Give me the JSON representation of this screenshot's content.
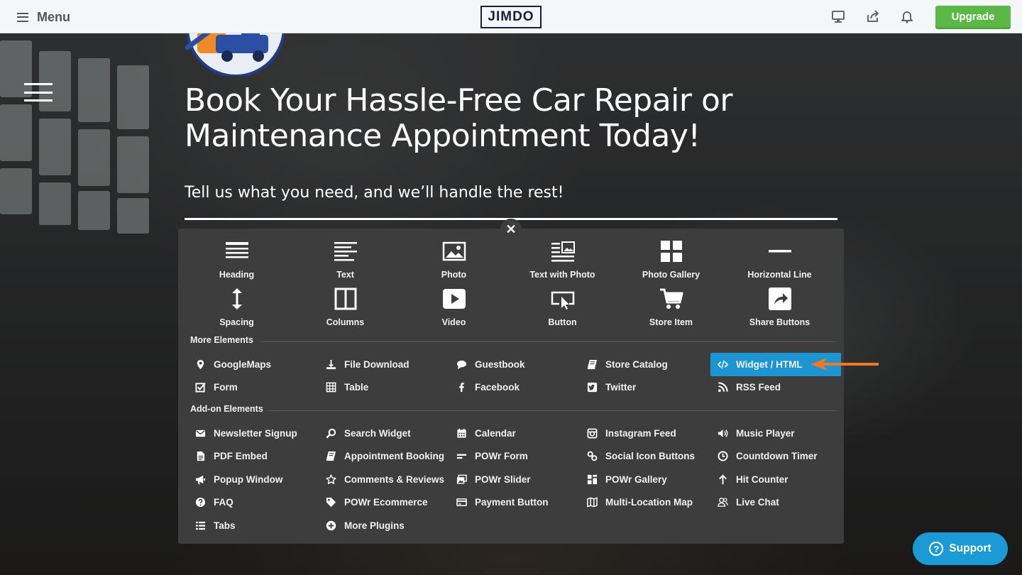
{
  "topbar": {
    "menu_label": "Menu",
    "logo_text": "JIMDO",
    "upgrade_label": "Upgrade",
    "icons": [
      "desktop-preview-icon",
      "share-icon",
      "bell-icon"
    ]
  },
  "hero": {
    "headline_line1": "Book Your Hassle-Free Car Repair or",
    "headline_line2": "Maintenance Appointment Today!",
    "subline": "Tell us what you need, and we’ll handle the rest!"
  },
  "panel": {
    "close_symbol": "✕",
    "basic_elements": [
      {
        "label": "Heading",
        "icon": "heading-icon"
      },
      {
        "label": "Text",
        "icon": "text-icon"
      },
      {
        "label": "Photo",
        "icon": "photo-icon"
      },
      {
        "label": "Text with Photo",
        "icon": "text-with-photo-icon"
      },
      {
        "label": "Photo Gallery",
        "icon": "photo-gallery-icon"
      },
      {
        "label": "Horizontal Line",
        "icon": "horizontal-line-icon"
      },
      {
        "label": "Spacing",
        "icon": "spacing-icon"
      },
      {
        "label": "Columns",
        "icon": "columns-icon"
      },
      {
        "label": "Video",
        "icon": "video-icon"
      },
      {
        "label": "Button",
        "icon": "button-icon"
      },
      {
        "label": "Store Item",
        "icon": "cart-icon"
      },
      {
        "label": "Share Buttons",
        "icon": "share-icon"
      }
    ],
    "more_title": "More Elements",
    "more_elements": [
      {
        "label": "GoogleMaps",
        "icon": "map-pin-icon"
      },
      {
        "label": "File Download",
        "icon": "download-icon"
      },
      {
        "label": "Guestbook",
        "icon": "speech-bubble-icon"
      },
      {
        "label": "Store Catalog",
        "icon": "book-icon"
      },
      {
        "label": "Widget / HTML",
        "icon": "code-icon",
        "active": true
      },
      {
        "label": "Form",
        "icon": "checkbox-icon"
      },
      {
        "label": "Table",
        "icon": "table-icon"
      },
      {
        "label": "Facebook",
        "icon": "facebook-icon"
      },
      {
        "label": "Twitter",
        "icon": "twitter-icon"
      },
      {
        "label": "RSS Feed",
        "icon": "rss-icon"
      }
    ],
    "addon_title": "Add-on Elements",
    "addon_elements": [
      {
        "label": "Newsletter Signup",
        "icon": "envelope-icon"
      },
      {
        "label": "Search Widget",
        "icon": "search-icon"
      },
      {
        "label": "Calendar",
        "icon": "calendar-icon"
      },
      {
        "label": "Instagram Feed",
        "icon": "instagram-icon"
      },
      {
        "label": "Music Player",
        "icon": "speaker-icon"
      },
      {
        "label": "PDF Embed",
        "icon": "document-icon"
      },
      {
        "label": "Appointment Booking",
        "icon": "book-icon"
      },
      {
        "label": "POWr Form",
        "icon": "form-lines-icon"
      },
      {
        "label": "Social Icon Buttons",
        "icon": "link-icon"
      },
      {
        "label": "Countdown Timer",
        "icon": "clock-icon"
      },
      {
        "label": "Popup Window",
        "icon": "megaphone-icon"
      },
      {
        "label": "Comments & Reviews",
        "icon": "star-icon"
      },
      {
        "label": "POWr Slider",
        "icon": "images-icon"
      },
      {
        "label": "POWr Gallery",
        "icon": "gallery-grid-icon"
      },
      {
        "label": "Hit Counter",
        "icon": "arrow-up-icon"
      },
      {
        "label": "FAQ",
        "icon": "question-circle-icon"
      },
      {
        "label": "POWr Ecommerce",
        "icon": "tag-icon"
      },
      {
        "label": "Payment Button",
        "icon": "credit-card-icon"
      },
      {
        "label": "Multi-Location Map",
        "icon": "folded-map-icon"
      },
      {
        "label": "Live Chat",
        "icon": "users-icon"
      },
      {
        "label": "Tabs",
        "icon": "list-icon"
      },
      {
        "label": "More Plugins",
        "icon": "plus-circle-icon"
      }
    ]
  },
  "support": {
    "label": "Support",
    "q": "?"
  },
  "colors": {
    "upgrade": "#5bb847",
    "active": "#1e95d3",
    "panel": "#3d3d3d",
    "arrow": "#f07a22",
    "support": "#1c9ad6"
  }
}
